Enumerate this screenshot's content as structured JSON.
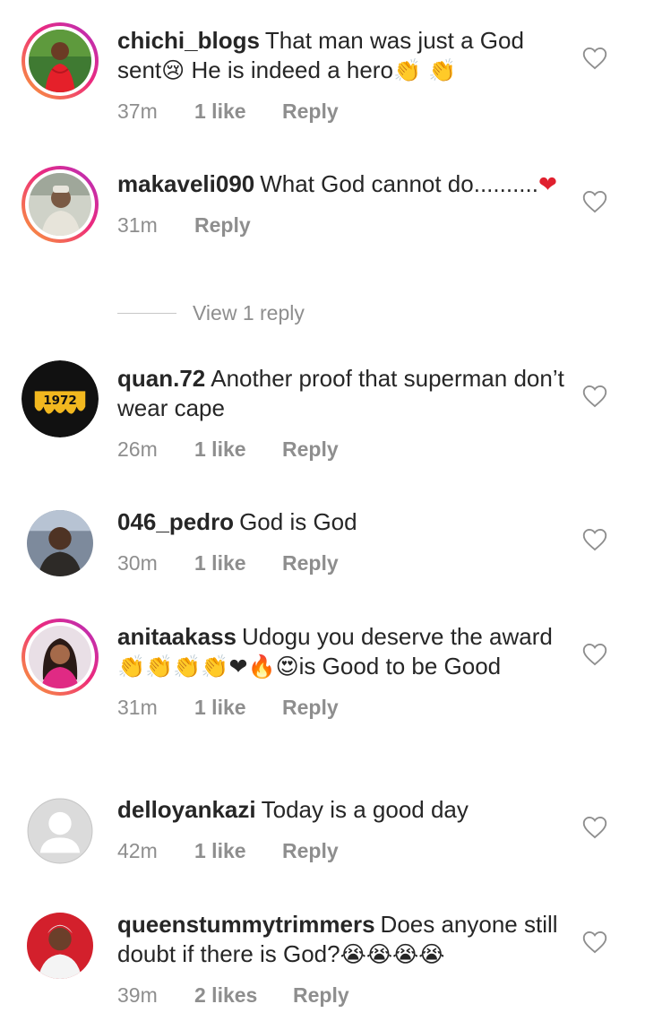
{
  "comments": [
    {
      "username": "chichi_blogs",
      "text": "That man was just a God sent",
      "emoji_a": "😢",
      "text_b": " He is indeed a hero",
      "emoji_b": "👏 👏",
      "time": "37m",
      "likes": "1 like",
      "reply": "Reply"
    },
    {
      "username": "makaveli090",
      "text": "What God cannot do..........",
      "emoji_a": "❤",
      "time": "31m",
      "reply": "Reply"
    },
    {
      "username": "quan.72",
      "text": "Another proof that superman don’t wear cape",
      "avatar_label": "1972",
      "time": "26m",
      "likes": "1 like",
      "reply": "Reply"
    },
    {
      "username": "046_pedro",
      "text": "God is God",
      "time": "30m",
      "likes": "1 like",
      "reply": "Reply"
    },
    {
      "username": "anitaakass",
      "text": "Udogu you deserve the award ",
      "emoji_a": "👏👏👏👏❤🔥😍",
      "text_b": "is Good to be Good",
      "time": "31m",
      "likes": "1 like",
      "reply": "Reply"
    },
    {
      "username": "delloyankazi",
      "text": "Today is a good day",
      "time": "42m",
      "likes": "1 like",
      "reply": "Reply"
    },
    {
      "username": "queenstummytrimmers",
      "text": "Does anyone still doubt if there is God?",
      "emoji_a": "😭😭😭😭",
      "time": "39m",
      "likes": "2 likes",
      "reply": "Reply"
    }
  ],
  "view_replies": "View 1 reply",
  "colors": {
    "muted": "#8e8e8e",
    "text": "#262626",
    "ring_start": "#f9a336",
    "ring_end": "#b12fc1"
  },
  "icons": {
    "like": "heart-outline-icon"
  }
}
